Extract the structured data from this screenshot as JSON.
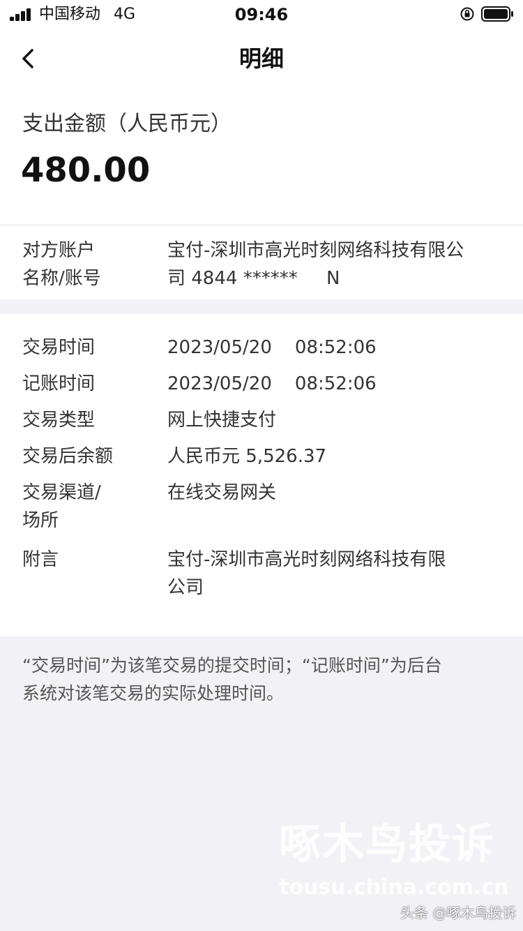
{
  "status_bar": {
    "carrier": "中国移动",
    "network": "4G",
    "time": "09:46",
    "icons": [
      "signal-icon",
      "orientation-lock-icon",
      "battery-icon"
    ]
  },
  "nav": {
    "title": "明细",
    "back_icon": "chevron-left-icon"
  },
  "amount": {
    "label": "支出金额（人民币元）",
    "value": "480.00"
  },
  "account": {
    "label_line1": "对方账户",
    "label_line2": "名称/账号",
    "value_line1": "宝付-深圳市高光时刻网络科技有限公",
    "value_line2": "司 4844 ******     N"
  },
  "details": {
    "rows": [
      {
        "label": "交易时间",
        "value": "2023/05/20    08:52:06"
      },
      {
        "label": "记账时间",
        "value": "2023/05/20    08:52:06"
      },
      {
        "label": "交易类型",
        "value": "网上快捷支付"
      },
      {
        "label": "交易后余额",
        "value": "人民币元 5,526.37"
      }
    ],
    "channel": {
      "label_line1": "交易渠道/",
      "label_line2": "场所",
      "value": "在线交易网关"
    },
    "remark": {
      "label": "附言",
      "value_line1": "宝付-深圳市高光时刻网络科技有限",
      "value_line2": "公司"
    }
  },
  "footnote": {
    "line1": "“交易时间”为该笔交易的提交时间；“记账时间”为后台",
    "line2": "系统对该笔交易的实际处理时间。"
  },
  "watermark": {
    "brand": "啄木鸟投诉",
    "url": "tousu.china.com.cn",
    "tag": "头条 @啄木鸟投诉"
  },
  "colors": {
    "background": "#f2f2f6",
    "card": "#ffffff",
    "text": "#222222"
  }
}
